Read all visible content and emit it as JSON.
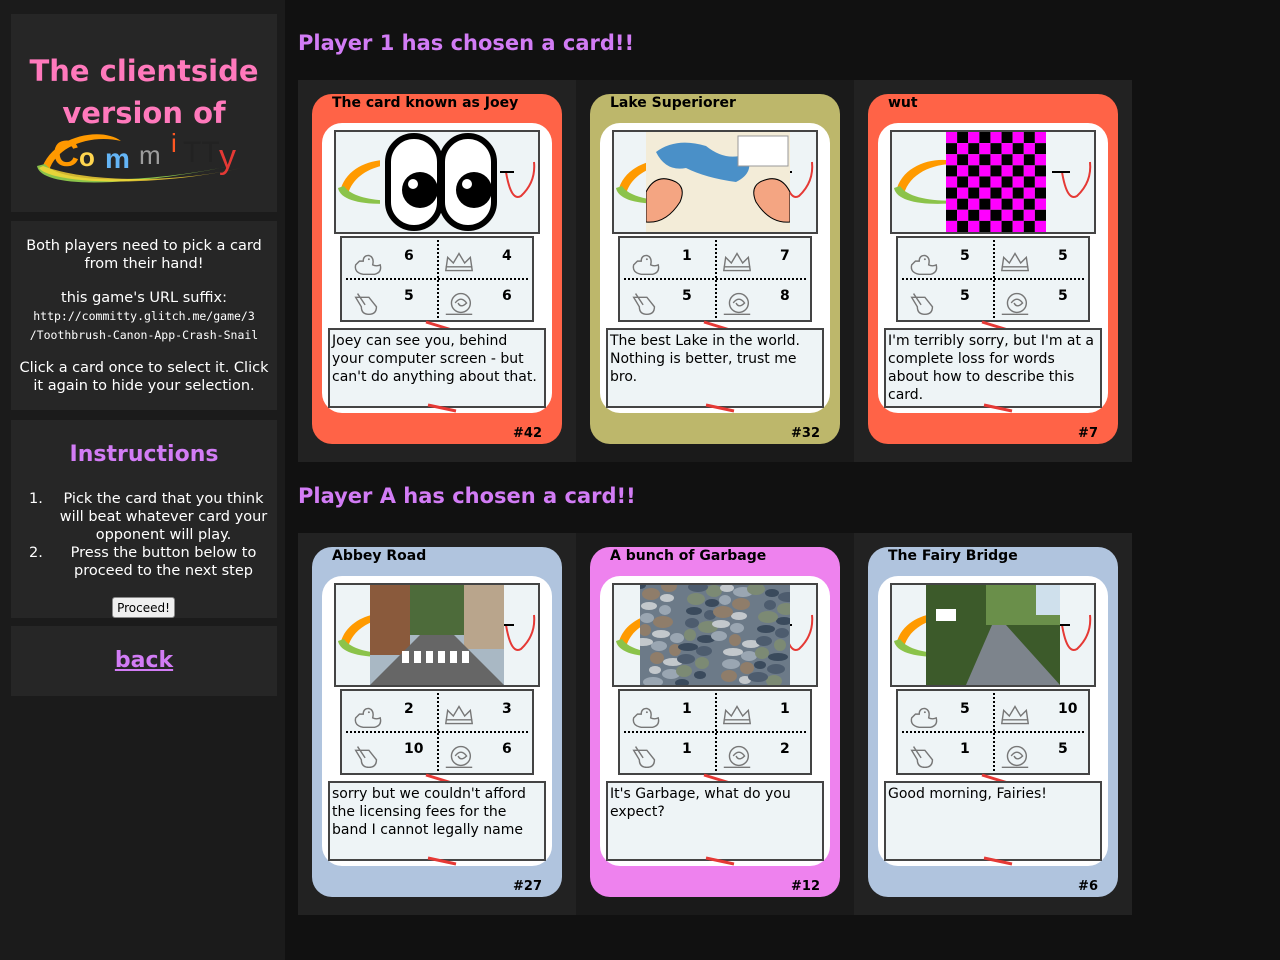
{
  "sidebar": {
    "title_line1": "The clientside",
    "title_line2": "version of",
    "logo_text": "committy",
    "info_line1": "Both players need to pick a card from their hand!",
    "url_label": "this game's URL suffix:",
    "url_line1": "http://committy.glitch.me/game/3",
    "url_line2": "/Toothbrush-Canon-App-Crash-Snail",
    "click_hint": "Click a card once to select it. Click it again to hide your selection.",
    "instructions_heading": "Instructions",
    "instructions": [
      {
        "num": "1.",
        "text": "Pick the card that you think will beat whatever card your opponent will play."
      },
      {
        "num": "2.",
        "text": "Press the button below to proceed to the next step"
      }
    ],
    "proceed_label": "Proceed!",
    "back_label": "back"
  },
  "hands": [
    {
      "heading": "Player 1 has chosen a card!!",
      "cards": [
        {
          "name": "The card known as Joey",
          "number": "#42",
          "color": "#ff6347",
          "image": "eyes-image",
          "stats": {
            "duck": "6",
            "crown": "4",
            "whistle": "5",
            "snail": "6"
          },
          "description": "Joey can see you, behind your computer screen - but can't do anything about that."
        },
        {
          "name": "Lake Superiorer",
          "number": "#32",
          "color": "#bdb76b",
          "image": "lake-muscle-image",
          "stats": {
            "duck": "1",
            "crown": "7",
            "whistle": "5",
            "snail": "8"
          },
          "description": "The best Lake in the world. Nothing is better, trust me bro."
        },
        {
          "name": "wut",
          "number": "#7",
          "color": "#ff6347",
          "image": "checkerboard-image",
          "stats": {
            "duck": "5",
            "crown": "5",
            "whistle": "5",
            "snail": "5"
          },
          "description": "I'm terribly sorry, but I'm at a complete loss for words about how to describe this card."
        }
      ]
    },
    {
      "heading": "Player A has chosen a card!!",
      "cards": [
        {
          "name": "Abbey Road",
          "number": "#27",
          "color": "#b0c4de",
          "image": "abbey-road-image",
          "stats": {
            "duck": "2",
            "crown": "3",
            "whistle": "10",
            "snail": "6"
          },
          "description": "sorry but we couldn't afford the licensing fees for the band I cannot legally name"
        },
        {
          "name": "A bunch of Garbage",
          "number": "#12",
          "color": "#ee82ee",
          "image": "garbage-image",
          "stats": {
            "duck": "1",
            "crown": "1",
            "whistle": "1",
            "snail": "2"
          },
          "description": "It's Garbage, what do you expect?"
        },
        {
          "name": "The Fairy Bridge",
          "number": "#6",
          "color": "#b0c4de",
          "image": "fairy-bridge-image",
          "stats": {
            "duck": "5",
            "crown": "10",
            "whistle": "1",
            "snail": "5"
          },
          "description": "Good morning, Fairies!"
        }
      ]
    }
  ],
  "colors": {
    "accent": "#d27cf5",
    "title_pink": "#ff79bc"
  }
}
